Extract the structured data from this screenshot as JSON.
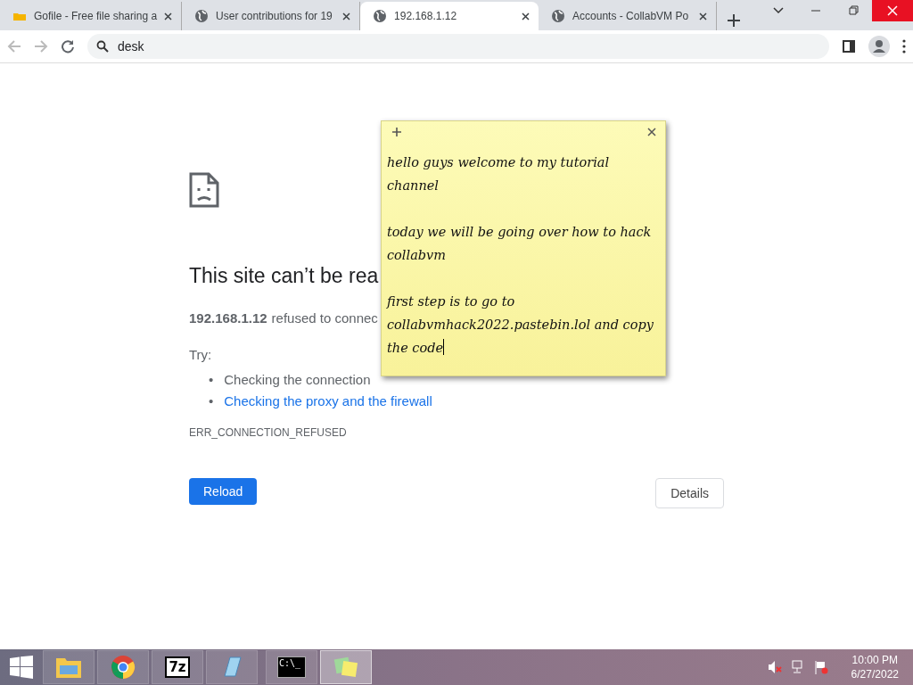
{
  "tabs": [
    {
      "title": "Gofile - Free file sharing a",
      "kind": "folder",
      "selected": false
    },
    {
      "title": "User contributions for 19",
      "kind": "site",
      "selected": false
    },
    {
      "title": "192.168.1.12",
      "kind": "site",
      "selected": true
    },
    {
      "title": "Accounts - CollabVM Po",
      "kind": "site",
      "selected": false
    }
  ],
  "address_bar": {
    "value": "desk"
  },
  "error_page": {
    "heading": "This site can’t be rea",
    "host": "192.168.1.12",
    "message": "refused to connec",
    "try_label": "Try:",
    "suggestions": [
      {
        "marker": "•",
        "text": "Checking the connection",
        "kind": "plain"
      },
      {
        "marker": "•",
        "text": "Checking the proxy and the firewall",
        "kind": "link"
      }
    ],
    "error_code": "ERR_CONNECTION_REFUSED",
    "reload_button": "Reload",
    "details_button": "Details"
  },
  "sticky_note": {
    "paragraphs": [
      "hello guys welcome to my tutorial channel",
      "today we will be going over how to hack collabvm",
      "first step is to go to collabvmhack2022.pastebin.lol and copy the code"
    ]
  },
  "taskbar": {
    "apps": [
      {
        "kind": "explorer",
        "selected": false
      },
      {
        "kind": "chrome",
        "selected": false
      },
      {
        "kind": "archiver",
        "label": "7z",
        "selected": false
      },
      {
        "kind": "notepad",
        "selected": false
      },
      {
        "kind": "console",
        "label": "C:\\_",
        "selected": false
      },
      {
        "kind": "notes",
        "selected": true
      }
    ],
    "time": "10:00 PM",
    "date": "6/27/2022"
  }
}
